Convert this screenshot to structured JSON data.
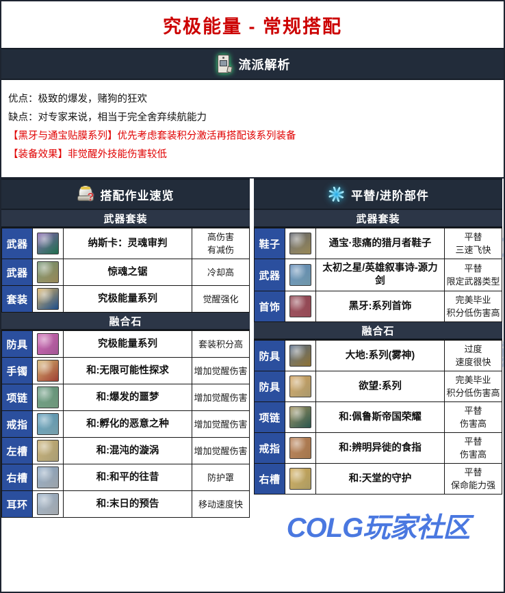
{
  "page": {
    "title": "究极能量 - 常规搭配",
    "title_color": "#cc0000",
    "watermark": "COLG玩家社区",
    "logo": "COLG玩家社区",
    "logo_color": "#4a78e0"
  },
  "analysis": {
    "icon": "scroll-icon",
    "header": "流派解析",
    "lines": [
      {
        "text": "优点：极致的爆发，赌狗的狂欢",
        "color": "#111111"
      },
      {
        "text": "缺点：对专家来说，相当于完全舍弃续航能力",
        "color": "#111111"
      },
      {
        "text": "【黑牙与通宝贴膜系列】优先考虑套装积分激活再搭配该系列装备",
        "color": "#e00000"
      },
      {
        "text": "【装备效果】非觉醒外技能伤害较低",
        "color": "#e00000"
      }
    ]
  },
  "left_panel": {
    "icon": "helmet-icon",
    "title": "搭配作业速览",
    "groups": [
      {
        "name": "武器套装",
        "rows": [
          {
            "slot": "武器",
            "icon_colors": [
              "#6b3fa0",
              "#2d9e6f"
            ],
            "name": "纳斯卡：灵魂审判",
            "tag": "高伤害\n有减伤"
          },
          {
            "slot": "武器",
            "icon_colors": [
              "#4f7a52",
              "#d8c07a"
            ],
            "name": "惊魂之锯",
            "tag": "冷却高"
          },
          {
            "slot": "套装",
            "icon_colors": [
              "#d8a33c",
              "#2a6fc4"
            ],
            "name": "究极能量系列",
            "tag": "觉醒强化"
          }
        ]
      },
      {
        "name": "融合石",
        "rows": [
          {
            "slot": "防具",
            "icon_colors": [
              "#c03fa0",
              "#e87ad2"
            ],
            "name": "究极能量系列",
            "tag": "套装积分高"
          },
          {
            "slot": "手镯",
            "icon_colors": [
              "#c9a24a",
              "#e35b4a"
            ],
            "name": "和:无限可能性探求",
            "tag": "增加觉醒伤害"
          },
          {
            "slot": "项链",
            "icon_colors": [
              "#3e7d5e",
              "#9fd8b0"
            ],
            "name": "和:爆发的噩梦",
            "tag": "增加觉醒伤害"
          },
          {
            "slot": "戒指",
            "icon_colors": [
              "#2e7fa8",
              "#a9e2f2"
            ],
            "name": "和:孵化的恶意之种",
            "tag": "增加觉醒伤害"
          },
          {
            "slot": "左槽",
            "icon_colors": [
              "#b99a4e",
              "#f1e0a6"
            ],
            "name": "和:混沌的漩涡",
            "tag": "增加觉醒伤害"
          },
          {
            "slot": "右槽",
            "icon_colors": [
              "#6b8fb5",
              "#dfe9f2"
            ],
            "name": "和:和平的往昔",
            "tag": "防护罩"
          },
          {
            "slot": "耳环",
            "icon_colors": [
              "#7d9ab8",
              "#e7eef6"
            ],
            "name": "和:末日的预告",
            "tag": "移动速度快"
          }
        ]
      }
    ]
  },
  "right_panel": {
    "icon": "swirl-icon",
    "title": "平替/进阶部件",
    "groups": [
      {
        "name": "武器套装",
        "rows": [
          {
            "slot": "鞋子",
            "icon_colors": [
              "#3a3f4d",
              "#d9c27a"
            ],
            "name": "通宝·悲痛的猎月者鞋子",
            "tag": "平替\n三速飞快"
          },
          {
            "slot": "武器",
            "icon_colors": [
              "#3b6fa8",
              "#9fd6f0"
            ],
            "name": "太初之星/英雄叙事诗-源力剑",
            "tag": "平替\n限定武器类型"
          },
          {
            "slot": "首饰",
            "icon_colors": [
              "#7a1f2e",
              "#d56a7a"
            ],
            "name": "黑牙:系列首饰",
            "tag": "完美毕业\n积分低伤害高"
          }
        ]
      },
      {
        "name": "融合石",
        "rows": [
          {
            "slot": "防具",
            "icon_colors": [
              "#2f4a6e",
              "#c9a24a"
            ],
            "name": "大地:系列(雾神)",
            "tag": "过度\n速度很快"
          },
          {
            "slot": "防具",
            "icon_colors": [
              "#c98f3a",
              "#f0d89a"
            ],
            "name": "欲望:系列",
            "tag": "完美毕业\n积分低伤害高"
          },
          {
            "slot": "项链",
            "icon_colors": [
              "#8c7a3a",
              "#3d7a6e"
            ],
            "name": "和:佩鲁斯帝国荣耀",
            "tag": "平替\n伤害高"
          },
          {
            "slot": "戒指",
            "icon_colors": [
              "#a8622e",
              "#e8a86e"
            ],
            "name": "和:辨明异徙的食指",
            "tag": "平替\n伤害高"
          },
          {
            "slot": "右槽",
            "icon_colors": [
              "#c4952e",
              "#f3dc8e"
            ],
            "name": "和:天堂的守护",
            "tag": "平替\n保命能力强"
          }
        ]
      }
    ]
  }
}
